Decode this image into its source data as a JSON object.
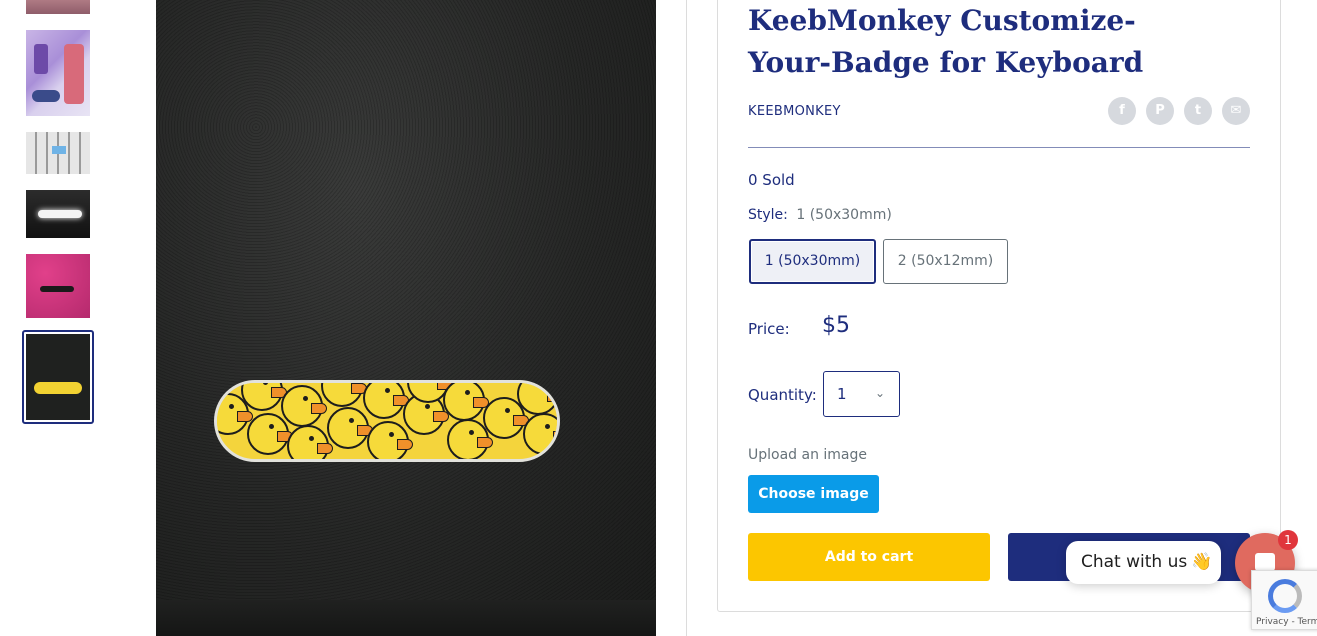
{
  "product": {
    "title": "KeebMonkey Customize-Your-Badge for Keyboard",
    "vendor": "KEEBMONKEY",
    "sold": "0 Sold",
    "style_label": "Style:",
    "style_value": "1 (50x30mm)",
    "options": [
      "1 (50x30mm)",
      "2 (50x12mm)"
    ],
    "selected_option": "1 (50x30mm)",
    "price_label": "Price:",
    "price": "$5",
    "quantity_label": "Quantity:",
    "quantity": "1",
    "upload_label": "Upload an image",
    "choose_image": "Choose image",
    "add_to_cart": "Add to cart"
  },
  "share_icons": [
    "facebook-icon",
    "pinterest-icon",
    "twitter-icon",
    "email-icon"
  ],
  "gallery": {
    "thumbnail_count": 6,
    "active_index": 5
  },
  "chat": {
    "label": "Chat with us",
    "emoji": "👋",
    "badge_count": "1"
  },
  "recaptcha": {
    "text": "Privacy - Terms"
  },
  "colors": {
    "primary": "#1e2d7d",
    "add_to_cart": "#fcc600",
    "choose_image": "#0a9be8",
    "chat": "#e06a5f"
  }
}
